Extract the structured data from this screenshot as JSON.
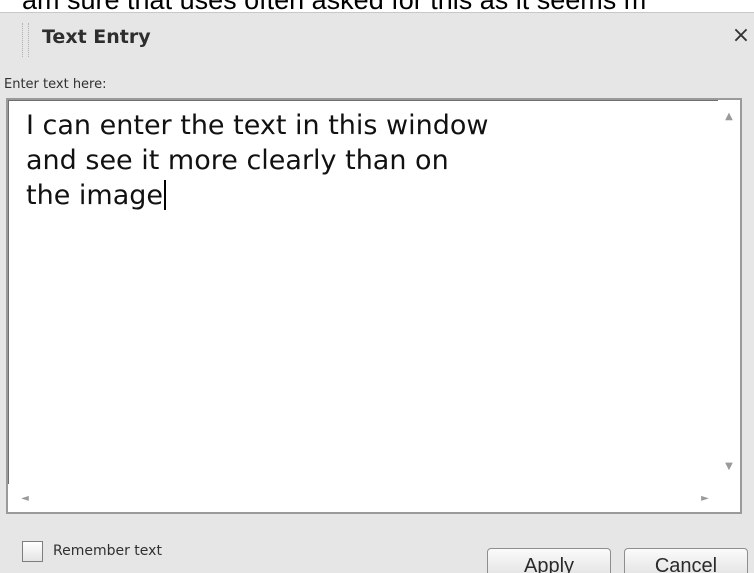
{
  "background_caption": "am sure that uses often asked for this as it seems m",
  "dialog": {
    "title": "Text Entry",
    "close_glyph": "×",
    "field_label": "Enter text here:",
    "text_value": "I can enter the text in this window\nand see it more clearly than on\nthe image",
    "scroll_up_glyph": "▲",
    "scroll_down_glyph": "▼",
    "scroll_left_glyph": "◄",
    "scroll_right_glyph": "►",
    "remember_label": "Remember text",
    "remember_checked": false,
    "apply_label": "Apply",
    "cancel_label": "Cancel"
  },
  "icons": {
    "close": "close-icon",
    "scroll_up": "scroll-up-arrow-icon",
    "scroll_down": "scroll-down-arrow-icon",
    "scroll_left": "scroll-left-arrow-icon",
    "scroll_right": "scroll-right-arrow-icon"
  }
}
